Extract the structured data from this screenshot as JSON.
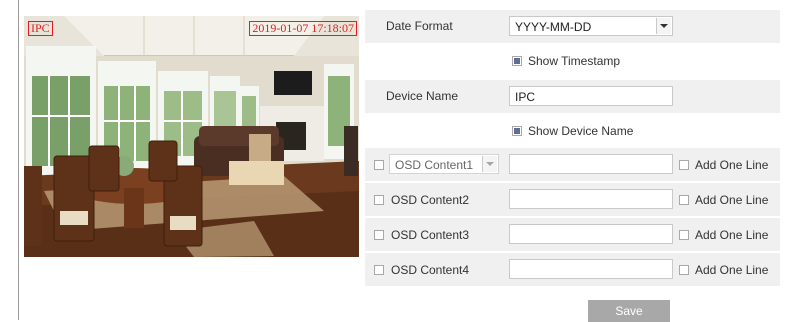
{
  "preview": {
    "osd_label": "IPC",
    "osd_timestamp": "2019-01-07 17:18:07"
  },
  "settings": {
    "date_format": {
      "label": "Date Format",
      "value": "YYYY-MM-DD"
    },
    "show_timestamp": {
      "label": "Show Timestamp",
      "checked": true
    },
    "device_name": {
      "label": "Device Name",
      "value": "IPC"
    },
    "show_device_name": {
      "label": "Show Device Name",
      "checked": true
    },
    "osd_contents": [
      {
        "label": "OSD Content1",
        "checked": false,
        "value": "",
        "add_line_label": "Add One Line",
        "add_line_checked": false
      },
      {
        "label": "OSD Content2",
        "checked": false,
        "value": "",
        "add_line_label": "Add One Line",
        "add_line_checked": false
      },
      {
        "label": "OSD Content3",
        "checked": false,
        "value": "",
        "add_line_label": "Add One Line",
        "add_line_checked": false
      },
      {
        "label": "OSD Content4",
        "checked": false,
        "value": "",
        "add_line_label": "Add One Line",
        "add_line_checked": false
      }
    ]
  },
  "save_label": "Save",
  "colors": {
    "osd_red": "#e0201e",
    "row_gray": "#f0f0f0",
    "save_gray": "#a8a8a8",
    "check_fill": "#5d6e94"
  }
}
